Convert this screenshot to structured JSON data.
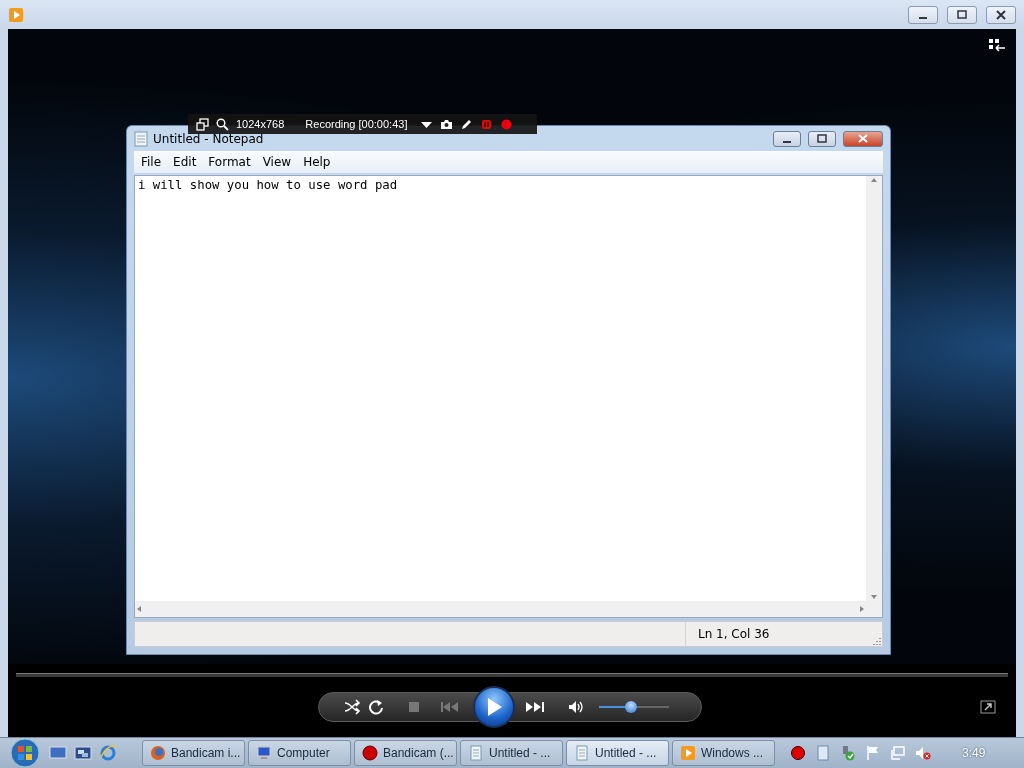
{
  "recording_toolbar": {
    "resolution": "1024x768",
    "status": "Recording [00:00:43]"
  },
  "notepad": {
    "title": "Untitled - Notepad",
    "menu": [
      {
        "label": "File"
      },
      {
        "label": "Edit"
      },
      {
        "label": "Format"
      },
      {
        "label": "View"
      },
      {
        "label": "Help"
      }
    ],
    "text": "i will show you how to use word pad",
    "status": "Ln 1, Col 36"
  },
  "player_controls": {
    "volume": {
      "level": 0.45
    }
  },
  "taskbar": {
    "tasks": [
      {
        "label": "Bandicam i...",
        "kind": "browser",
        "selected": false
      },
      {
        "label": "Computer",
        "kind": "computer",
        "selected": false
      },
      {
        "label": "Bandicam (...",
        "kind": "recorder",
        "selected": false
      },
      {
        "label": "Untitled - ...",
        "kind": "notepad",
        "selected": false
      },
      {
        "label": "Untitled - ...",
        "kind": "notepad",
        "selected": true
      },
      {
        "label": "Windows ...",
        "kind": "player",
        "selected": false
      }
    ],
    "clock": "3:49"
  }
}
